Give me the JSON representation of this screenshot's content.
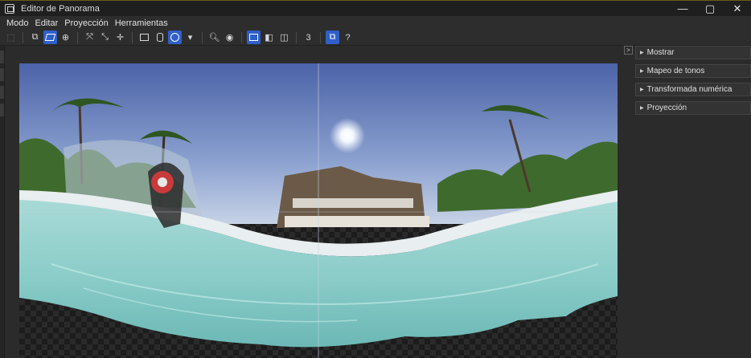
{
  "window": {
    "title": "Editor de Panorama",
    "controls": {
      "minimize": "—",
      "maximize": "▢",
      "close": "✕"
    }
  },
  "menu": [
    "Modo",
    "Editar",
    "Proyección",
    "Herramientas"
  ],
  "toolbar": {
    "groups": [
      [
        {
          "name": "select-icon",
          "glyph": "⬚",
          "state": "disabled"
        }
      ],
      [
        {
          "name": "move-layers-icon",
          "glyph": "⧉",
          "state": "normal"
        },
        {
          "name": "distort-icon",
          "glyph": "para",
          "state": "active"
        },
        {
          "name": "center-target-icon",
          "glyph": "⊕",
          "state": "normal"
        }
      ],
      [
        {
          "name": "fit-all-icon",
          "glyph": "⤧",
          "state": "normal"
        },
        {
          "name": "fit-inward-icon",
          "glyph": "⤡",
          "state": "normal"
        },
        {
          "name": "straighten-icon",
          "glyph": "✛",
          "state": "normal"
        }
      ],
      [
        {
          "name": "planar-projection-icon",
          "glyph": "rect",
          "state": "normal"
        },
        {
          "name": "cylindrical-projection-icon",
          "glyph": "cyl",
          "state": "normal"
        },
        {
          "name": "spherical-projection-icon",
          "glyph": "sph",
          "state": "active"
        },
        {
          "name": "projection-dropdown-icon",
          "glyph": "▾",
          "state": "normal"
        }
      ],
      [
        {
          "name": "zoom-icon",
          "glyph": "🔍︎",
          "state": "normal"
        },
        {
          "name": "preview-eye-icon",
          "glyph": "◉",
          "state": "normal"
        }
      ],
      [
        {
          "name": "single-view-icon",
          "glyph": "rect",
          "state": "active"
        },
        {
          "name": "split-view-icon",
          "glyph": "◧",
          "state": "normal"
        },
        {
          "name": "book-view-icon",
          "glyph": "◫",
          "state": "normal"
        }
      ],
      [
        {
          "name": "three-d-icon",
          "glyph": "3",
          "state": "normal"
        }
      ],
      [
        {
          "name": "layers-icon",
          "glyph": "⧉",
          "state": "active"
        },
        {
          "name": "help-icon",
          "glyph": "?",
          "state": "normal"
        }
      ]
    ]
  },
  "panel": {
    "sections": [
      "Mostrar",
      "Mapeo de tonos",
      "Transformada numérica",
      "Proyección"
    ],
    "collapse_glyph": ">"
  },
  "colors": {
    "accent": "#2f5fc9",
    "titlebar": "#1f1f1f",
    "background": "#2b2b2b"
  }
}
